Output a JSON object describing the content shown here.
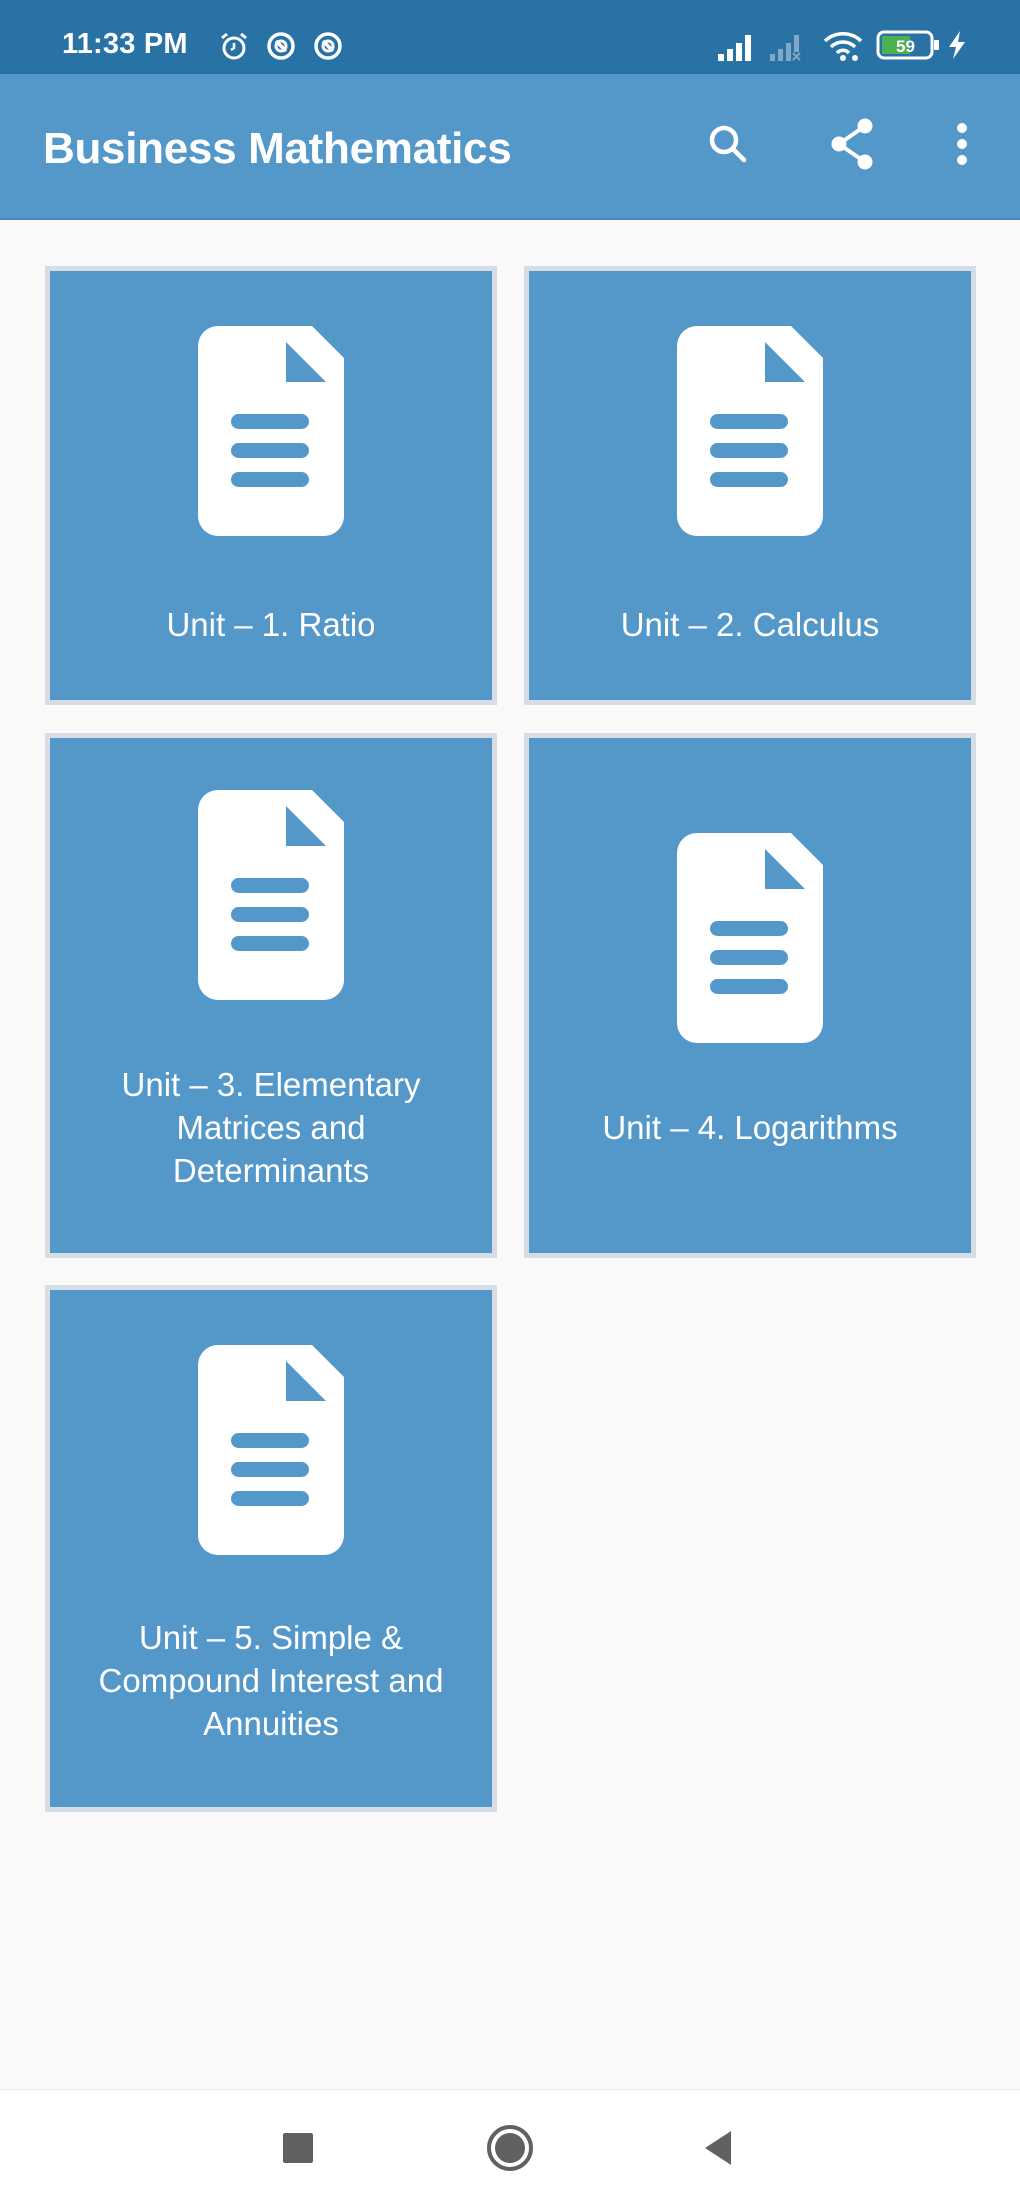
{
  "status_bar": {
    "time": "11:33 PM",
    "left_icons": [
      "alarm-icon",
      "data-saver-icon",
      "data-saver-icon"
    ],
    "right_icons": [
      "signal-full-icon",
      "signal-empty-icon",
      "wifi-icon",
      "battery-icon",
      "charging-icon"
    ],
    "battery_level": "59",
    "battery_color": "#4caf50"
  },
  "app_bar": {
    "title": "Business Mathematics",
    "actions": [
      {
        "name": "search",
        "icon": "search-icon"
      },
      {
        "name": "share",
        "icon": "share-icon"
      },
      {
        "name": "more",
        "icon": "more-vert-icon"
      }
    ]
  },
  "theme": {
    "primary": "#5498c9",
    "primary_dark": "#2872a6",
    "background": "#f9f9fa"
  },
  "units": [
    {
      "label": "Unit – 1. Ratio",
      "icon": "document-icon"
    },
    {
      "label": "Unit – 2. Calculus",
      "icon": "document-icon"
    },
    {
      "label": "Unit – 3. Elementary Matrices and Determinants",
      "icon": "document-icon"
    },
    {
      "label": "Unit – 4. Logarithms",
      "icon": "document-icon"
    },
    {
      "label": "Unit – 5. Simple & Compound Interest and Annuities",
      "icon": "document-icon"
    }
  ],
  "nav_bar": {
    "buttons": [
      {
        "name": "recents",
        "icon": "square-icon"
      },
      {
        "name": "home",
        "icon": "circle-icon"
      },
      {
        "name": "back",
        "icon": "triangle-back-icon"
      }
    ]
  }
}
